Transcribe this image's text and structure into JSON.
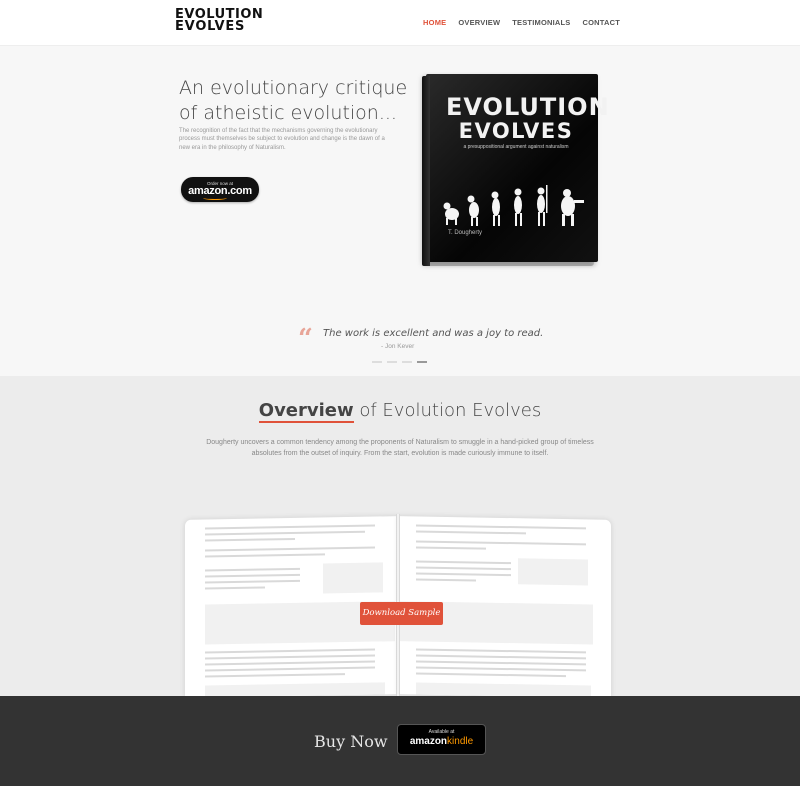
{
  "header": {
    "logo_line1": "EVOLUTION",
    "logo_line2": "EVOLVES",
    "nav": [
      "HOME",
      "OVERVIEW",
      "TESTIMONIALS",
      "CONTACT"
    ],
    "active_nav": "HOME",
    "accent_color": "#e0523a"
  },
  "hero": {
    "title": "An evolutionary critique of atheistic evolution...",
    "description": "The recognition of the fact that the mechanisms governing the evolutionary process must themselves be subject to evolution and change is the dawn of a new era in the philosophy of Naturalism.",
    "amazon_button": {
      "small": "Order now at",
      "big": "amazon.com"
    },
    "book": {
      "title_line1": "EVOLUTION",
      "title_line2": "EVOLVES",
      "subtitle": "a presuppositional argument against naturalism",
      "author": "T. Dougherty"
    }
  },
  "testimonial": {
    "quote_icon": "quote-icon",
    "text": "The work is excellent and was a joy to read.",
    "author": "- Jon Kever",
    "slides": 4,
    "active_slide": 4
  },
  "overview": {
    "title_strong": "Overview",
    "title_rest": " of Evolution Evolves",
    "description": "Dougherty uncovers a common tendency among the proponents of Naturalism to smuggle in a hand-picked group of timeless absolutes from the outset of inquiry. From the start, evolution is made curiously immune to itself.",
    "download_button": "Download Sample"
  },
  "footer": {
    "buy_now": "Buy Now",
    "kindle_button": {
      "small": "Available at",
      "amazon": "amazon",
      "kindle": "kindle"
    },
    "background": "#333333"
  }
}
